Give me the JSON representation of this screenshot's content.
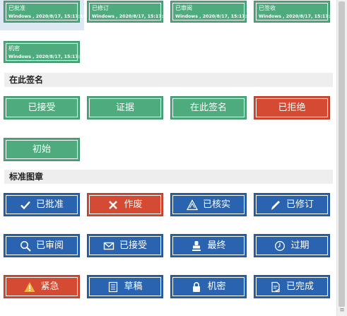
{
  "small_stamps": [
    {
      "title": "已批准",
      "meta": "Windows , 2020/8/17, 15:17:16"
    },
    {
      "title": "已修订",
      "meta": "Windows , 2020/8/17, 15:17:16"
    },
    {
      "title": "已审阅",
      "meta": "Windows , 2020/8/17, 15:17:16"
    },
    {
      "title": "已签收",
      "meta": "Windows , 2020/8/17, 15:17:16"
    },
    {
      "title": "机密",
      "meta": "Windows , 2020/8/17, 15:17:16"
    }
  ],
  "sign_here": {
    "title": "在此签名",
    "stamps": [
      {
        "label": "已接受",
        "color": "#4dab7e"
      },
      {
        "label": "证据",
        "color": "#4dab7e"
      },
      {
        "label": "在此签名",
        "color": "#4dab7e"
      },
      {
        "label": "已拒绝",
        "color": "#d44a32"
      },
      {
        "label": "初始",
        "color": "#4dab7e"
      }
    ]
  },
  "standard": {
    "title": "标准图章",
    "stamps": [
      {
        "label": "已批准",
        "icon": "check-icon"
      },
      {
        "label": "作废",
        "icon": "x-icon"
      },
      {
        "label": "已核实",
        "icon": "triangle-icon"
      },
      {
        "label": "已修订",
        "icon": "pen-icon"
      },
      {
        "label": "已审阅",
        "icon": "magnifier-icon"
      },
      {
        "label": "已接受",
        "icon": "envelope-icon"
      },
      {
        "label": "最终",
        "icon": "stamp-icon"
      },
      {
        "label": "过期",
        "icon": "clock-icon"
      },
      {
        "label": "紧急",
        "icon": "warning-icon"
      },
      {
        "label": "草稿",
        "icon": "document-icon"
      },
      {
        "label": "机密",
        "icon": "lock-icon"
      },
      {
        "label": "已完成",
        "icon": "completed-doc-icon"
      }
    ]
  },
  "colors": {
    "green": "#4dab7e",
    "red": "#d44a32",
    "blue": "#2a64b0"
  }
}
